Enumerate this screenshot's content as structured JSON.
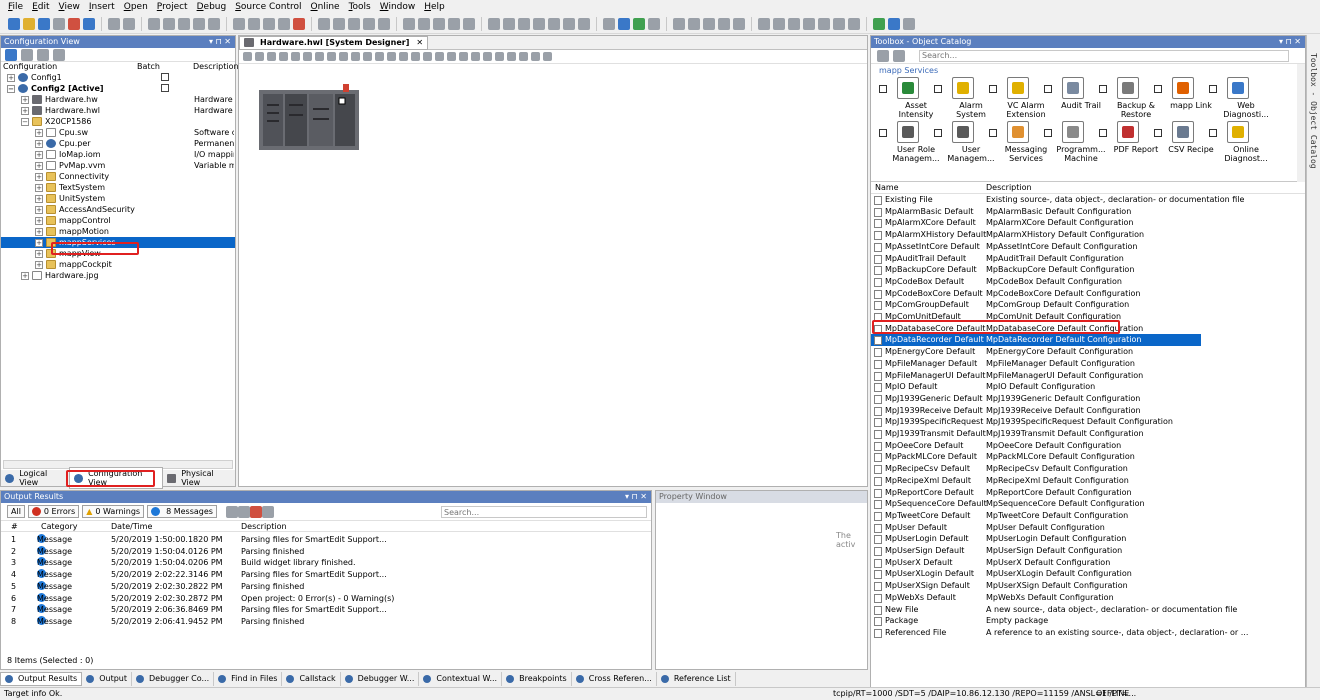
{
  "menu": [
    "File",
    "Edit",
    "View",
    "Insert",
    "Open",
    "Project",
    "Debug",
    "Source Control",
    "Online",
    "Tools",
    "Window",
    "Help"
  ],
  "config_panel": {
    "title": "Configuration View",
    "pin": "▾ ⊓ ✕",
    "columns": {
      "configuration": "Configuration",
      "batch": "Batch",
      "description": "Description"
    },
    "tree": [
      {
        "label": "Config1",
        "depth": 0,
        "icon": "gear",
        "exp": "+",
        "batch": true
      },
      {
        "label": "Config2 [Active]",
        "depth": 0,
        "icon": "gear",
        "exp": "−",
        "bold": true,
        "batch": true
      },
      {
        "label": "Hardware.hw",
        "depth": 1,
        "icon": "hw",
        "exp": "+",
        "desc": "Hardware cc"
      },
      {
        "label": "Hardware.hwl",
        "depth": 1,
        "icon": "hw",
        "exp": "+",
        "desc": "Hardware to"
      },
      {
        "label": "X20CP1586",
        "depth": 1,
        "icon": "folder",
        "exp": "−"
      },
      {
        "label": "Cpu.sw",
        "depth": 2,
        "icon": "file",
        "exp": "+",
        "desc": "Software cor"
      },
      {
        "label": "Cpu.per",
        "depth": 2,
        "icon": "gear",
        "exp": "+",
        "desc": "Permanent v"
      },
      {
        "label": "IoMap.iom",
        "depth": 2,
        "icon": "file",
        "exp": "+",
        "desc": "I/O mapping"
      },
      {
        "label": "PvMap.vvm",
        "depth": 2,
        "icon": "file",
        "exp": "+",
        "desc": "Variable map"
      },
      {
        "label": "Connectivity",
        "depth": 2,
        "icon": "folder",
        "exp": "+"
      },
      {
        "label": "TextSystem",
        "depth": 2,
        "icon": "folder",
        "exp": "+"
      },
      {
        "label": "UnitSystem",
        "depth": 2,
        "icon": "folder",
        "exp": "+"
      },
      {
        "label": "AccessAndSecurity",
        "depth": 2,
        "icon": "folder",
        "exp": "+"
      },
      {
        "label": "mappControl",
        "depth": 2,
        "icon": "folder",
        "exp": "+"
      },
      {
        "label": "mappMotion",
        "depth": 2,
        "icon": "folder",
        "exp": "+"
      },
      {
        "label": "mappServices",
        "depth": 2,
        "icon": "folder",
        "exp": "+",
        "selected": true
      },
      {
        "label": "mappView",
        "depth": 2,
        "icon": "folder",
        "exp": "+"
      },
      {
        "label": "mappCockpit",
        "depth": 2,
        "icon": "folder",
        "exp": "+"
      },
      {
        "label": "Hardware.jpg",
        "depth": 1,
        "icon": "file",
        "exp": "+"
      }
    ],
    "bottom_tabs": [
      "Logical View",
      "Configuration View",
      "Physical View"
    ]
  },
  "designer": {
    "tab": "Hardware.hwl [System Designer]",
    "close": "✕"
  },
  "toolbox": {
    "title": "Toolbox - Object Catalog",
    "search_placeholder": "Search...",
    "category": "mapp Services",
    "side_label": "Toolbox - Object Catalog",
    "items": [
      {
        "label": "Asset Intensity",
        "color": "#2a8a3a"
      },
      {
        "label": "Alarm System",
        "color": "#e0b000"
      },
      {
        "label": "VC Alarm Extension",
        "color": "#e0b000"
      },
      {
        "label": "Audit Trail",
        "color": "#7a8aa0"
      },
      {
        "label": "Backup & Restore",
        "color": "#7a7a7a"
      },
      {
        "label": "mapp Link",
        "color": "#e06000"
      },
      {
        "label": "Web Diagnosti...",
        "color": "#3a78c8"
      },
      {
        "label": "User Role Managem...",
        "color": "#5a5a5a"
      },
      {
        "label": "User Managem...",
        "color": "#5a5a5a"
      },
      {
        "label": "Messaging Services",
        "color": "#e09030"
      },
      {
        "label": "Programm... Machine",
        "color": "#8a8a8a"
      },
      {
        "label": "PDF Report",
        "color": "#c03030"
      },
      {
        "label": "CSV Recipe",
        "color": "#6a7a90"
      },
      {
        "label": "Online Diagnost...",
        "color": "#e0b000"
      }
    ],
    "list_headers": {
      "name": "Name",
      "description": "Description"
    },
    "list": [
      [
        "Existing File",
        "Existing source-, data object-, declaration- or documentation file"
      ],
      [
        "MpAlarmBasic Default",
        "MpAlarmBasic Default Configuration"
      ],
      [
        "MpAlarmXCore Default",
        "MpAlarmXCore Default Configuration"
      ],
      [
        "MpAlarmXHistory Default",
        "MpAlarmXHistory Default Configuration"
      ],
      [
        "MpAssetIntCore Default",
        "MpAssetIntCore Default Configuration"
      ],
      [
        "MpAuditTrail Default",
        "MpAuditTrail Default Configuration"
      ],
      [
        "MpBackupCore Default",
        "MpBackupCore Default Configuration"
      ],
      [
        "MpCodeBox Default",
        "MpCodeBox Default Configuration"
      ],
      [
        "MpCodeBoxCore Default",
        "MpCodeBoxCore Default Configuration"
      ],
      [
        "MpComGroupDefault",
        "MpComGroup Default Configuration"
      ],
      [
        "MpComUnitDefault",
        "MpComUnit Default Configuration"
      ],
      [
        "MpDatabaseCore Default",
        "MpDatabaseCore Default Configuration"
      ],
      [
        "MpDataRecorder Default",
        "MpDataRecorder Default Configuration"
      ],
      [
        "MpEnergyCore Default",
        "MpEnergyCore Default Configuration"
      ],
      [
        "MpFileManager Default",
        "MpFileManager Default Configuration"
      ],
      [
        "MpFileManagerUI Default",
        "MpFileManagerUI Default Configuration"
      ],
      [
        "MpIO Default",
        "MpIO Default Configuration"
      ],
      [
        "MpJ1939Generic Default",
        "MpJ1939Generic Default Configuration"
      ],
      [
        "MpJ1939Receive Default",
        "MpJ1939Receive Default Configuration"
      ],
      [
        "MpJ1939SpecificRequest ...",
        "MpJ1939SpecificRequest Default Configuration"
      ],
      [
        "MpJ1939Transmit Default",
        "MpJ1939Transmit Default Configuration"
      ],
      [
        "MpOeeCore Default",
        "MpOeeCore Default Configuration"
      ],
      [
        "MpPackMLCore Default",
        "MpPackMLCore Default Configuration"
      ],
      [
        "MpRecipeCsv Default",
        "MpRecipeCsv Default Configuration"
      ],
      [
        "MpRecipeXml Default",
        "MpRecipeXml Default Configuration"
      ],
      [
        "MpReportCore Default",
        "MpReportCore Default Configuration"
      ],
      [
        "MpSequenceCore Default",
        "MpSequenceCore Default Configuration"
      ],
      [
        "MpTweetCore Default",
        "MpTweetCore Default Configuration"
      ],
      [
        "MpUser Default",
        "MpUser Default Configuration"
      ],
      [
        "MpUserLogin Default",
        "MpUserLogin Default Configuration"
      ],
      [
        "MpUserSign Default",
        "MpUserSign Default Configuration"
      ],
      [
        "MpUserX Default",
        "MpUserX Default Configuration"
      ],
      [
        "MpUserXLogin Default",
        "MpUserXLogin Default Configuration"
      ],
      [
        "MpUserXSign Default",
        "MpUserXSign Default Configuration"
      ],
      [
        "MpWebXs Default",
        "MpWebXs Default Configuration"
      ],
      [
        "New File",
        "A new source-, data object-, declaration- or documentation file"
      ],
      [
        "Package",
        "Empty package"
      ],
      [
        "Referenced File",
        "A reference to an existing source-, data object-, declaration- or ..."
      ]
    ],
    "selected_index": 12
  },
  "output": {
    "title": "Output Results",
    "filters": {
      "all": "All",
      "errors": "0 Errors",
      "warnings": "0 Warnings",
      "messages": "8 Messages"
    },
    "search_placeholder": "Search...",
    "headers": {
      "num": "#",
      "category": "Category",
      "date": "Date/Time",
      "description": "Description"
    },
    "rows": [
      [
        "1",
        "Message",
        "5/20/2019 1:50:00.1820 PM",
        "Parsing files for SmartEdit Support..."
      ],
      [
        "2",
        "Message",
        "5/20/2019 1:50:04.0126 PM",
        "Parsing finished"
      ],
      [
        "3",
        "Message",
        "5/20/2019 1:50:04.0206 PM",
        "Build widget library finished."
      ],
      [
        "4",
        "Message",
        "5/20/2019 2:02:22.3146 PM",
        "Parsing files for SmartEdit Support..."
      ],
      [
        "5",
        "Message",
        "5/20/2019 2:02:30.2822 PM",
        "Parsing finished"
      ],
      [
        "6",
        "Message",
        "5/20/2019 2:02:30.2872 PM",
        "Open project: 0 Error(s) - 0 Warning(s)"
      ],
      [
        "7",
        "Message",
        "5/20/2019 2:06:36.8469 PM",
        "Parsing files for SmartEdit Support..."
      ],
      [
        "8",
        "Message",
        "5/20/2019 2:06:41.9452 PM",
        "Parsing finished"
      ]
    ],
    "footer": "8 Items (Selected : 0)"
  },
  "property": {
    "title": "Property Window",
    "partial_text": "The activ"
  },
  "bottom_tabs": [
    "Output Results",
    "Output",
    "Debugger Co...",
    "Find in Files",
    "Callstack",
    "Debugger W...",
    "Contextual W...",
    "Breakpoints",
    "Cross Referen...",
    "Reference List"
  ],
  "status": {
    "left": "Target info Ok.",
    "connection": "tcpip/RT=1000 /SDT=5 /DAIP=10.86.12.130 /REPO=11159 /ANSL=1 /PT=...",
    "mode": "OFFLINE"
  }
}
